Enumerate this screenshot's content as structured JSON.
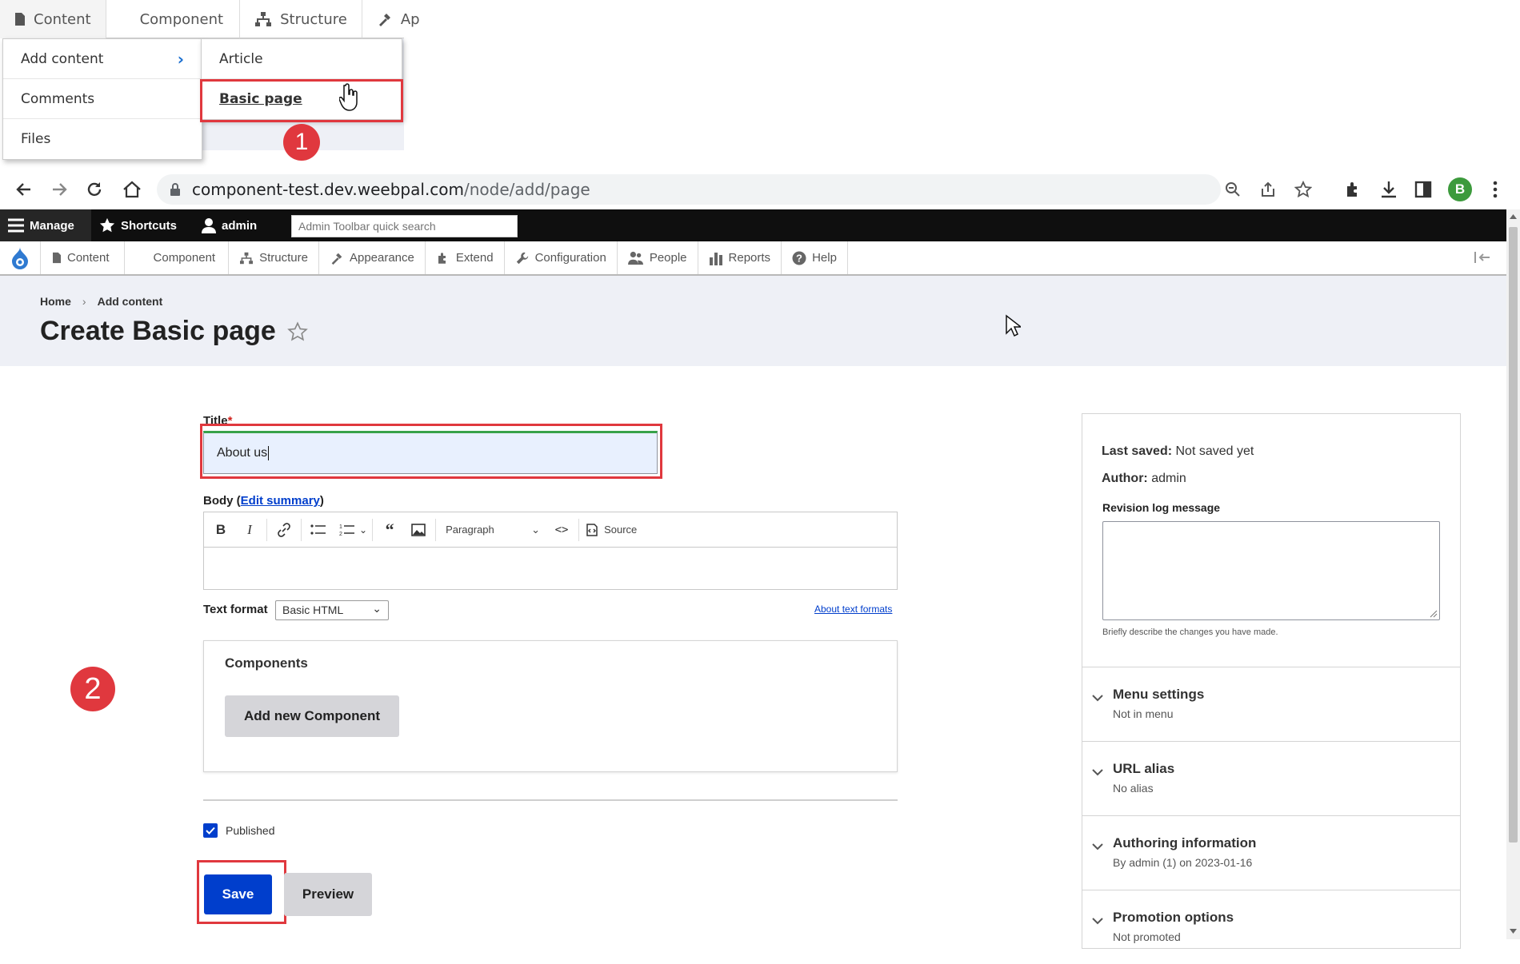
{
  "inset": {
    "menu_bar": [
      "Content",
      "Component",
      "Structure",
      "Ap"
    ],
    "dropdown_left": [
      "Add content",
      "Comments",
      "Files"
    ],
    "dropdown_right": [
      "Article",
      "Basic page"
    ],
    "badge_1": "1"
  },
  "browser": {
    "url_host": "component-test.dev.weebpal.com",
    "url_path": "/node/add/page",
    "profile_initial": "B"
  },
  "toolbar": {
    "manage": "Manage",
    "shortcuts": "Shortcuts",
    "user": "admin",
    "search_placeholder": "Admin Toolbar quick search"
  },
  "tray": [
    "Content",
    "Component",
    "Structure",
    "Appearance",
    "Extend",
    "Configuration",
    "People",
    "Reports",
    "Help"
  ],
  "breadcrumb": [
    "Home",
    "Add content"
  ],
  "page_title": "Create Basic page",
  "form": {
    "title_label": "Title",
    "required_mark": "*",
    "title_value": "About us",
    "body_label": "Body (",
    "edit_summary": "Edit summary",
    "body_label_close": ")",
    "paragraph": "Paragraph",
    "source": "Source",
    "text_format_label": "Text format",
    "text_format_value": "Basic HTML",
    "about_text_formats": "About text formats",
    "components_title": "Components",
    "add_component": "Add new Component",
    "published": "Published",
    "save": "Save",
    "preview": "Preview"
  },
  "badge_2": "2",
  "sidebar": {
    "last_saved_label": "Last saved:",
    "last_saved_value": "Not saved yet",
    "author_label": "Author:",
    "author_value": "admin",
    "revision_label": "Revision log message",
    "revision_help": "Briefly describe the changes you have made.",
    "sections": [
      {
        "title": "Menu settings",
        "summary": "Not in menu"
      },
      {
        "title": "URL alias",
        "summary": "No alias"
      },
      {
        "title": "Authoring information",
        "summary": "By admin (1) on 2023-01-16"
      },
      {
        "title": "Promotion options",
        "summary": "Not promoted"
      }
    ]
  },
  "colors": {
    "accent_red": "#e0383e",
    "primary_blue": "#003ecc",
    "toolbar_bg": "#0f0f0f",
    "header_bg": "#eef0f6"
  }
}
